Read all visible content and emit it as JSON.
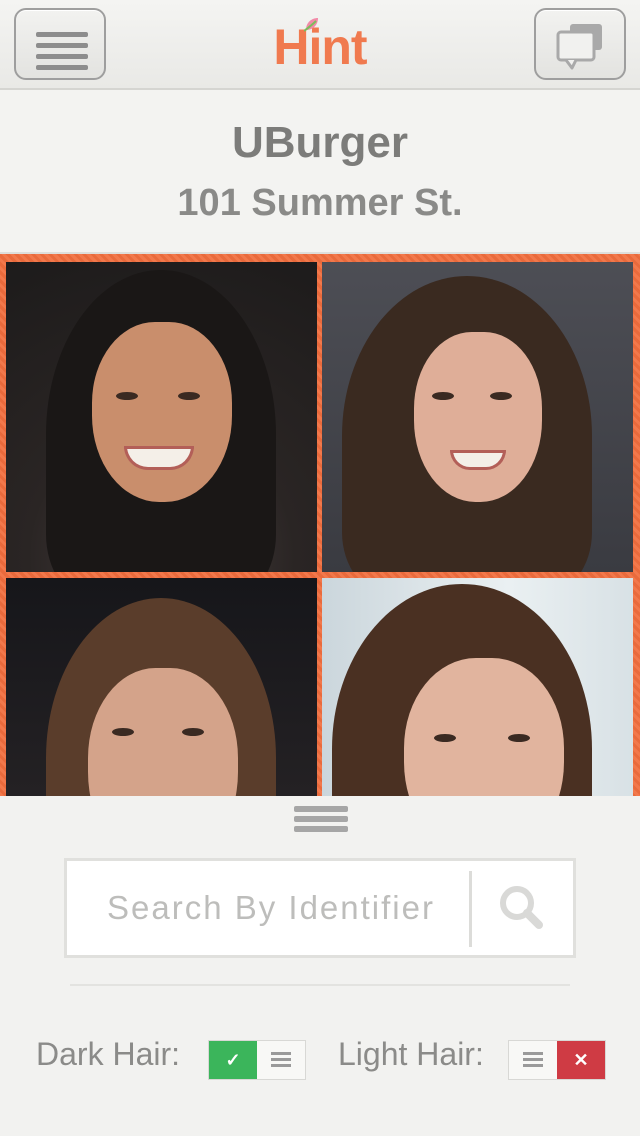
{
  "app": {
    "logo_text": "Hint"
  },
  "navbar": {
    "menu_icon": "hamburger-icon",
    "chat_icon": "chat-bubbles-icon"
  },
  "venue": {
    "name": "UBurger",
    "address": "101 Summer St."
  },
  "grid": {
    "photos": [
      {
        "alt": "photo-1"
      },
      {
        "alt": "photo-2"
      },
      {
        "alt": "photo-3"
      },
      {
        "alt": "photo-4"
      }
    ]
  },
  "search": {
    "placeholder": "Search By Identifier",
    "value": "",
    "icon": "search-icon"
  },
  "filters": {
    "dark_hair": {
      "label": "Dark Hair:",
      "state": "yes"
    },
    "light_hair": {
      "label": "Light Hair:",
      "state": "no"
    }
  },
  "colors": {
    "accent": "#f07a4f",
    "toggle_yes": "#3bb55b",
    "toggle_no": "#cf3b44"
  }
}
